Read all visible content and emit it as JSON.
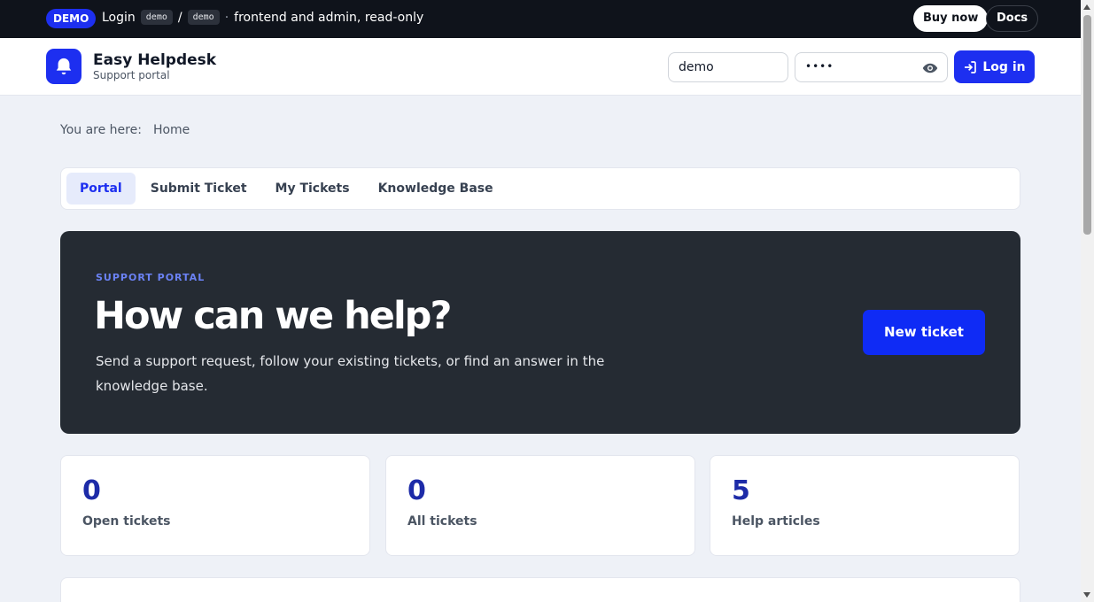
{
  "demo_bar": {
    "badge": "DEMO",
    "login_label": "Login",
    "user_code": "demo",
    "separator": "/",
    "pass_code": "demo",
    "dot": "·",
    "note": "frontend and admin, read-only",
    "buy_label": "Buy now",
    "docs_label": "Docs"
  },
  "header": {
    "logo_icon": "bell-icon",
    "brand_name": "Easy Helpdesk",
    "brand_sub": "Support portal",
    "username_value": "demo",
    "password_mask": "••••",
    "login_label": "Log in"
  },
  "breadcrumb": {
    "prefix": "You are here:",
    "current": "Home"
  },
  "tabs": [
    {
      "label": "Portal",
      "active": true
    },
    {
      "label": "Submit Ticket",
      "active": false
    },
    {
      "label": "My Tickets",
      "active": false
    },
    {
      "label": "Knowledge Base",
      "active": false
    }
  ],
  "hero": {
    "kicker": "SUPPORT PORTAL",
    "title": "How can we help?",
    "description": "Send a support request, follow your existing tickets, or find an answer in the knowledge base.",
    "button_label": "New ticket"
  },
  "stats": [
    {
      "value": "0",
      "label": "Open tickets"
    },
    {
      "value": "0",
      "label": "All tickets"
    },
    {
      "value": "5",
      "label": "Help articles"
    }
  ],
  "colors": {
    "accent": "#1d2ff0",
    "hero_bg": "#252b33",
    "page_bg": "#eef1f7",
    "stat_value": "#1d2ba8"
  }
}
